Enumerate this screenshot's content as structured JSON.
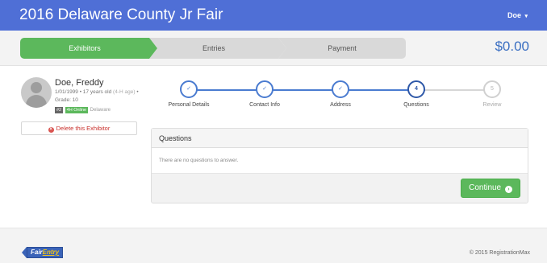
{
  "header": {
    "title": "2016 Delaware County Jr Fair",
    "user": "Doe",
    "user_caret": "▾"
  },
  "stepbar": {
    "steps": [
      {
        "label": "Exhibitors",
        "state": "active"
      },
      {
        "label": "Entries",
        "state": "inactive"
      },
      {
        "label": "Payment",
        "state": "inactive"
      }
    ],
    "total": "$0.00"
  },
  "exhibitor": {
    "name": "Doe, Freddy",
    "dob_age": "1/01/1999 • 17 years old",
    "age_note": "(4-H age)",
    "grade": "• Grade: 10",
    "badges": [
      "#2",
      "4H Online"
    ],
    "county": "Delaware",
    "delete_label": "Delete this Exhibitor"
  },
  "progress": {
    "steps": [
      {
        "label": "Personal Details",
        "marker": "✓",
        "state": "done"
      },
      {
        "label": "Contact Info",
        "marker": "✓",
        "state": "done"
      },
      {
        "label": "Address",
        "marker": "✓",
        "state": "done"
      },
      {
        "label": "Questions",
        "marker": "4",
        "state": "current"
      },
      {
        "label": "Review",
        "marker": "5",
        "state": "todo"
      }
    ]
  },
  "questions": {
    "heading": "Questions",
    "empty_message": "There are no questions to answer.",
    "continue_label": "Continue",
    "continue_icon": "›"
  },
  "footer": {
    "logo_part1": "Fair",
    "logo_part2": "Entry",
    "copyright": "© 2015 RegistrationMax"
  },
  "colors": {
    "header_blue": "#4f6fd6",
    "success_green": "#5cb85c",
    "progress_blue": "#4a7bd0",
    "total_blue": "#3b6fc2",
    "danger_red": "#d9534f"
  }
}
